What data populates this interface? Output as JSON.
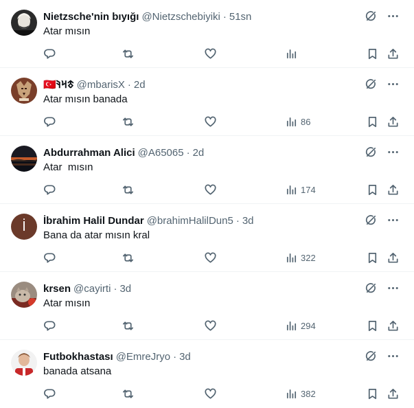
{
  "tweets": [
    {
      "name": "Nietzsche'nin bıyığı",
      "handle": "@Nietzschebiyiki",
      "time": "51sn",
      "text": "Atar mısın",
      "views": ""
    },
    {
      "name": "🇹🇷𐱃𐰺𐰚",
      "handle": "@mbarisX",
      "time": "2d",
      "text": "Atar mısın banada",
      "views": "86"
    },
    {
      "name": "Abdurrahman Alici",
      "handle": "@A65065",
      "time": "2d",
      "text": "Atar  mısın",
      "views": "174"
    },
    {
      "name": "İbrahim Halil Dundar",
      "handle": "@brahimHalilDun5",
      "time": "3d",
      "text": "Bana da atar mısın kral",
      "views": "322",
      "avatar_letter": "İ"
    },
    {
      "name": "krsen",
      "handle": "@cayirti",
      "time": "3d",
      "text": "Atar mısın",
      "views": "294"
    },
    {
      "name": "Futbokhastası",
      "handle": "@EmreJryo",
      "time": "3d",
      "text": "banada atsana",
      "views": "382"
    }
  ],
  "separator": "·",
  "icons": {
    "top": [
      "grok-icon",
      "more-icon"
    ],
    "actions": [
      "reply-icon",
      "retweet-icon",
      "like-icon",
      "views-icon",
      "bookmark-icon",
      "share-icon"
    ]
  },
  "colors": {
    "text": "#0f1419",
    "secondary": "#536471",
    "divider": "#eff3f4"
  }
}
